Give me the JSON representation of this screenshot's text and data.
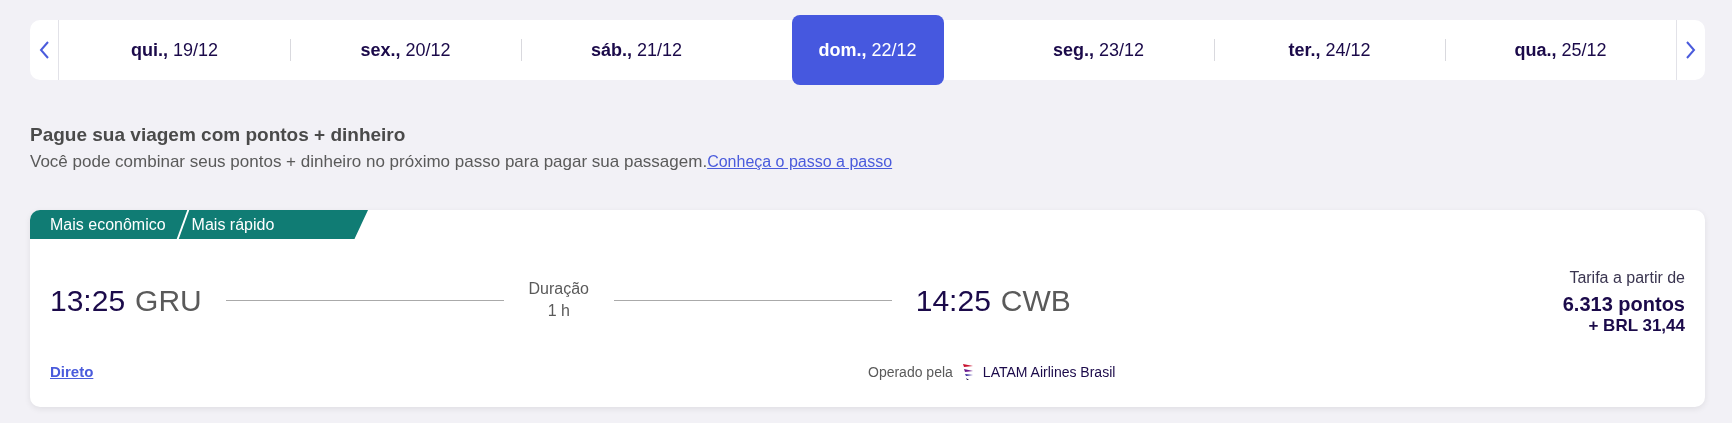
{
  "date_bar": {
    "days": [
      {
        "day": "qui.,",
        "date": "19/12",
        "selected": false
      },
      {
        "day": "sex.,",
        "date": "20/12",
        "selected": false
      },
      {
        "day": "sáb.,",
        "date": "21/12",
        "selected": false
      },
      {
        "day": "dom.,",
        "date": "22/12",
        "selected": true
      },
      {
        "day": "seg.,",
        "date": "23/12",
        "selected": false
      },
      {
        "day": "ter.,",
        "date": "24/12",
        "selected": false
      },
      {
        "day": "qua.,",
        "date": "25/12",
        "selected": false
      }
    ]
  },
  "promo": {
    "title": "Pague sua viagem com pontos + dinheiro",
    "text": "Você pode combinar seus pontos + dinheiro no próximo passo para pagar sua passagem.",
    "link": "Conheça o passo a passo"
  },
  "flight": {
    "tags": [
      "Mais econômico",
      "Mais rápido"
    ],
    "departure": {
      "time": "13:25",
      "airport": "GRU"
    },
    "duration": {
      "label": "Duração",
      "value": "1 h"
    },
    "arrival": {
      "time": "14:25",
      "airport": "CWB"
    },
    "price": {
      "label": "Tarifa a partir de",
      "points": "6.313 pontos",
      "money": "+ BRL 31,44"
    },
    "stops": "Direto",
    "operated_by": {
      "label": "Operado pela",
      "airline": "LATAM Airlines Brasil"
    }
  }
}
